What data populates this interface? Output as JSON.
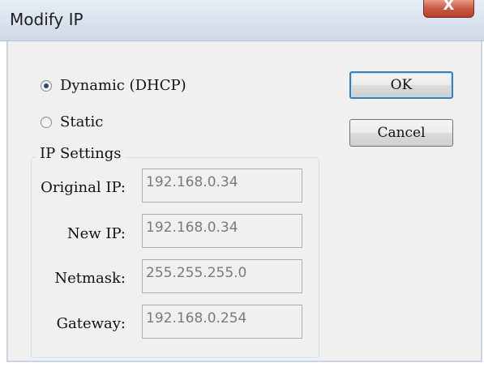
{
  "window": {
    "title": "Modify IP",
    "close_label": "X"
  },
  "mode": {
    "dhcp_label": "Dynamic (DHCP)",
    "static_label": "Static",
    "selected": "dhcp"
  },
  "buttons": {
    "ok_label": "OK",
    "cancel_label": "Cancel"
  },
  "ip_settings": {
    "group_label": "IP Settings",
    "original_ip_label": "Original IP:",
    "original_ip_value": "192.168.0.34",
    "new_ip_label": "New IP:",
    "new_ip_value": "192.168.0.34",
    "netmask_label": "Netmask:",
    "netmask_value": "255.255.255.0",
    "gateway_label": "Gateway:",
    "gateway_value": "192.168.0.254"
  }
}
